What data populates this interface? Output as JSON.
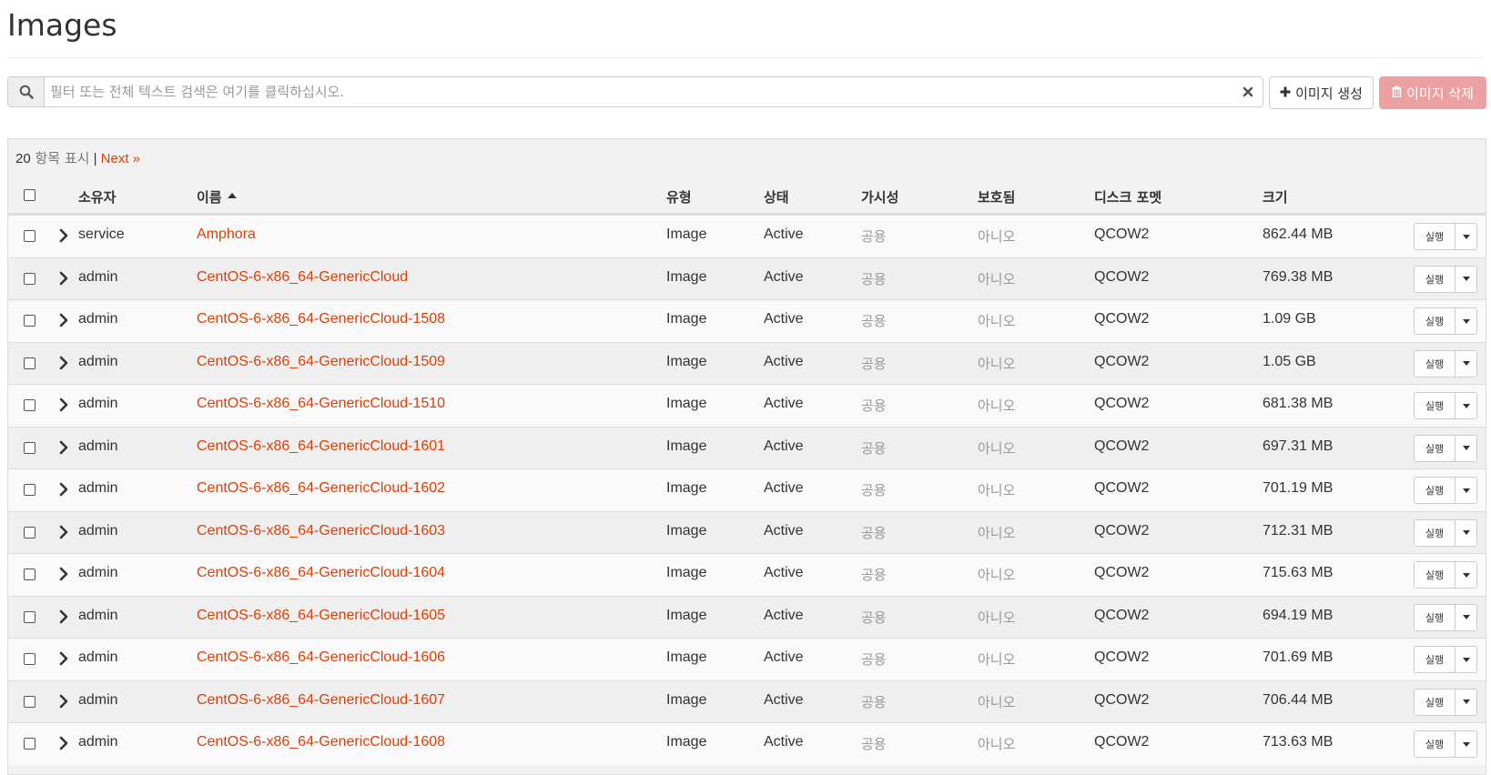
{
  "page": {
    "title": "Images"
  },
  "toolbar": {
    "search_placeholder": "필터 또는 전체 텍스트 검색은 여기를 클릭하십시오.",
    "search_value": "",
    "create_label": "이미지 생성",
    "delete_label": "이미지 삭제"
  },
  "table": {
    "count": "20",
    "count_suffix": " 항목 표시",
    "separator": " | ",
    "next_label": "Next »",
    "headers": {
      "owner": "소유자",
      "name": "이름",
      "type": "유형",
      "status": "상태",
      "visibility": "가시성",
      "protected": "보호됨",
      "disk_format": "디스크 포멧",
      "size": "크기"
    },
    "action_label": "실행",
    "rows": [
      {
        "owner": "service",
        "name": "Amphora",
        "type": "Image",
        "status": "Active",
        "visibility": "공용",
        "protected": "아니오",
        "disk_format": "QCOW2",
        "size": "862.44 MB"
      },
      {
        "owner": "admin",
        "name": "CentOS-6-x86_64-GenericCloud",
        "type": "Image",
        "status": "Active",
        "visibility": "공용",
        "protected": "아니오",
        "disk_format": "QCOW2",
        "size": "769.38 MB"
      },
      {
        "owner": "admin",
        "name": "CentOS-6-x86_64-GenericCloud-1508",
        "type": "Image",
        "status": "Active",
        "visibility": "공용",
        "protected": "아니오",
        "disk_format": "QCOW2",
        "size": "1.09 GB"
      },
      {
        "owner": "admin",
        "name": "CentOS-6-x86_64-GenericCloud-1509",
        "type": "Image",
        "status": "Active",
        "visibility": "공용",
        "protected": "아니오",
        "disk_format": "QCOW2",
        "size": "1.05 GB"
      },
      {
        "owner": "admin",
        "name": "CentOS-6-x86_64-GenericCloud-1510",
        "type": "Image",
        "status": "Active",
        "visibility": "공용",
        "protected": "아니오",
        "disk_format": "QCOW2",
        "size": "681.38 MB"
      },
      {
        "owner": "admin",
        "name": "CentOS-6-x86_64-GenericCloud-1601",
        "type": "Image",
        "status": "Active",
        "visibility": "공용",
        "protected": "아니오",
        "disk_format": "QCOW2",
        "size": "697.31 MB"
      },
      {
        "owner": "admin",
        "name": "CentOS-6-x86_64-GenericCloud-1602",
        "type": "Image",
        "status": "Active",
        "visibility": "공용",
        "protected": "아니오",
        "disk_format": "QCOW2",
        "size": "701.19 MB"
      },
      {
        "owner": "admin",
        "name": "CentOS-6-x86_64-GenericCloud-1603",
        "type": "Image",
        "status": "Active",
        "visibility": "공용",
        "protected": "아니오",
        "disk_format": "QCOW2",
        "size": "712.31 MB"
      },
      {
        "owner": "admin",
        "name": "CentOS-6-x86_64-GenericCloud-1604",
        "type": "Image",
        "status": "Active",
        "visibility": "공용",
        "protected": "아니오",
        "disk_format": "QCOW2",
        "size": "715.63 MB"
      },
      {
        "owner": "admin",
        "name": "CentOS-6-x86_64-GenericCloud-1605",
        "type": "Image",
        "status": "Active",
        "visibility": "공용",
        "protected": "아니오",
        "disk_format": "QCOW2",
        "size": "694.19 MB"
      },
      {
        "owner": "admin",
        "name": "CentOS-6-x86_64-GenericCloud-1606",
        "type": "Image",
        "status": "Active",
        "visibility": "공용",
        "protected": "아니오",
        "disk_format": "QCOW2",
        "size": "701.69 MB"
      },
      {
        "owner": "admin",
        "name": "CentOS-6-x86_64-GenericCloud-1607",
        "type": "Image",
        "status": "Active",
        "visibility": "공용",
        "protected": "아니오",
        "disk_format": "QCOW2",
        "size": "706.44 MB"
      },
      {
        "owner": "admin",
        "name": "CentOS-6-x86_64-GenericCloud-1608",
        "type": "Image",
        "status": "Active",
        "visibility": "공용",
        "protected": "아니오",
        "disk_format": "QCOW2",
        "size": "713.63 MB"
      }
    ]
  },
  "colors": {
    "link": "#e23d04",
    "danger_disabled": "#eba1a1",
    "muted": "#999999"
  },
  "icons": {
    "search": "search-icon",
    "clear": "close-icon",
    "create": "plus-icon",
    "delete": "trash-icon",
    "expand": "chevron-right-icon",
    "sort": "sort-asc-icon",
    "dropdown": "caret-down-icon"
  }
}
